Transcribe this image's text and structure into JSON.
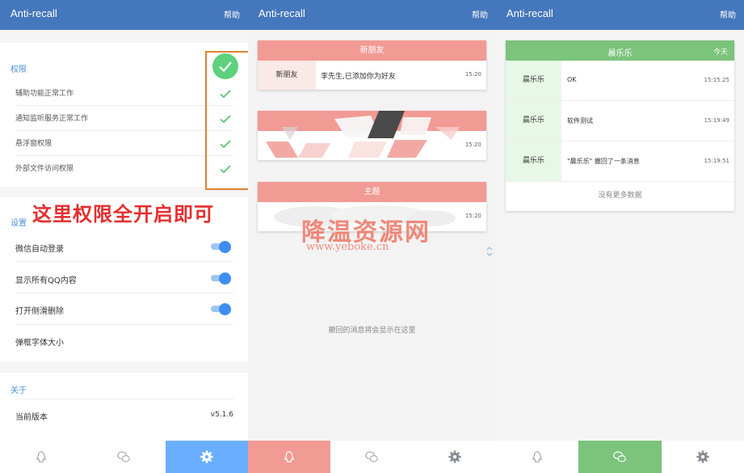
{
  "app": {
    "title": "Anti-recall",
    "help_label": "帮助"
  },
  "settings_screen": {
    "permissions_header": "权限",
    "permissions": [
      {
        "label": "辅助功能正常工作",
        "granted": true
      },
      {
        "label": "通知监听服务正常工作",
        "granted": true
      },
      {
        "label": "悬浮窗权限",
        "granted": true
      },
      {
        "label": "外部文件访问权限",
        "granted": true
      }
    ],
    "overlay_note": "这里权限全开启即可",
    "settings_header": "设置",
    "toggles": [
      {
        "label": "微信自动登录",
        "on": true
      },
      {
        "label": "显示所有QQ内容",
        "on": true
      },
      {
        "label": "打开侧滑删除",
        "on": true
      }
    ],
    "font_size_label": "弹框字体大小",
    "about_header": "关于",
    "version_label": "当前版本",
    "version_value": "v5.1.6"
  },
  "qq_screen": {
    "cards": [
      {
        "header": "新朋友",
        "name": "新朋友",
        "message": "李先生,已添加你为好友",
        "time": "15:20"
      },
      {
        "header": "",
        "name": "",
        "message": "",
        "time": "15:20"
      },
      {
        "header": "主题",
        "name": "",
        "message": "",
        "time": "15:20"
      }
    ],
    "empty_hint": "撤回的消息将会显示在这里",
    "watermark_text": "降温资源网",
    "watermark_url": "www.yeboke.cn"
  },
  "wechat_screen": {
    "contact": "晨乐乐",
    "date_label": "今天",
    "messages": [
      {
        "name": "晨乐乐",
        "text": "OK",
        "time": "15:15:25"
      },
      {
        "name": "晨乐乐",
        "text": "软件测试",
        "time": "15:19:49"
      },
      {
        "name": "晨乐乐",
        "text": "\"晨乐乐\" 撤回了一条消息",
        "time": "15:19:51"
      }
    ],
    "no_more": "没有更多数据"
  },
  "colors": {
    "appbar": "#4577bd",
    "settings_accent": "#6aafff",
    "qq_accent": "#f29a94",
    "wechat_accent": "#7cc37c",
    "check_green": "#4cc36a",
    "highlight_border": "#e0822f",
    "overlay_red": "#e62e2e"
  },
  "nav": [
    {
      "icon": "qq-penguin-icon"
    },
    {
      "icon": "wechat-icon"
    },
    {
      "icon": "gear-icon"
    }
  ]
}
